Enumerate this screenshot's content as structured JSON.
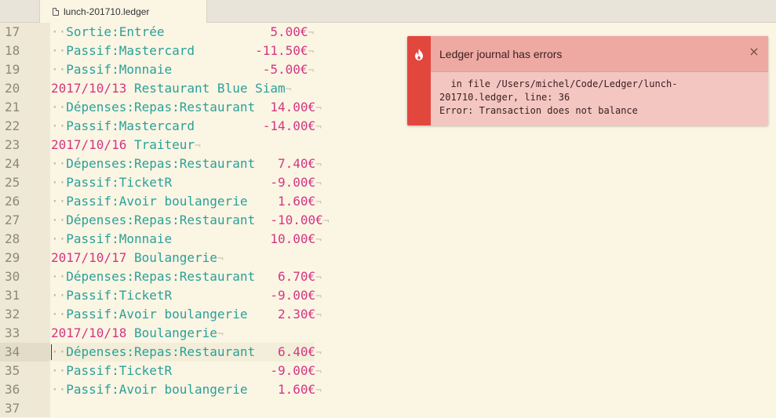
{
  "tab": {
    "filename": "lunch-201710.ledger"
  },
  "lines": [
    {
      "num": "17",
      "indent": true,
      "text": "Sortie:Entrée",
      "pad": "              ",
      "amount": "5.00€",
      "kind": "posting"
    },
    {
      "num": "18",
      "indent": true,
      "text": "Passif:Mastercard",
      "pad": "        ",
      "amount": "-11.50€",
      "kind": "posting"
    },
    {
      "num": "19",
      "indent": true,
      "text": "Passif:Monnaie",
      "pad": "            ",
      "amount": "-5.00€",
      "kind": "posting"
    },
    {
      "num": "20",
      "indent": false,
      "date": "2017/10/13",
      "text": "Restaurant Blue Siam",
      "kind": "header"
    },
    {
      "num": "21",
      "indent": true,
      "text": "Dépenses:Repas:Restaurant",
      "pad": "  ",
      "amount": "14.00€",
      "kind": "posting"
    },
    {
      "num": "22",
      "indent": true,
      "text": "Passif:Mastercard",
      "pad": "         ",
      "amount": "-14.00€",
      "kind": "posting"
    },
    {
      "num": "23",
      "indent": false,
      "date": "2017/10/16",
      "text": "Traiteur",
      "kind": "header"
    },
    {
      "num": "24",
      "indent": true,
      "text": "Dépenses:Repas:Restaurant",
      "pad": "   ",
      "amount": "7.40€",
      "kind": "posting"
    },
    {
      "num": "25",
      "indent": true,
      "text": "Passif:TicketR",
      "pad": "             ",
      "amount": "-9.00€",
      "kind": "posting"
    },
    {
      "num": "26",
      "indent": true,
      "text": "Passif:Avoir boulangerie",
      "pad": "    ",
      "amount": "1.60€",
      "kind": "posting"
    },
    {
      "num": "27",
      "indent": true,
      "text": "Dépenses:Repas:Restaurant",
      "pad": "  ",
      "amount": "-10.00€",
      "kind": "posting"
    },
    {
      "num": "28",
      "indent": true,
      "text": "Passif:Monnaie",
      "pad": "             ",
      "amount": "10.00€",
      "kind": "posting"
    },
    {
      "num": "29",
      "indent": false,
      "date": "2017/10/17",
      "text": "Boulangerie",
      "kind": "header"
    },
    {
      "num": "30",
      "indent": true,
      "text": "Dépenses:Repas:Restaurant",
      "pad": "   ",
      "amount": "6.70€",
      "kind": "posting"
    },
    {
      "num": "31",
      "indent": true,
      "text": "Passif:TicketR",
      "pad": "             ",
      "amount": "-9.00€",
      "kind": "posting"
    },
    {
      "num": "32",
      "indent": true,
      "text": "Passif:Avoir boulangerie",
      "pad": "    ",
      "amount": "2.30€",
      "kind": "posting"
    },
    {
      "num": "33",
      "indent": false,
      "date": "2017/10/18",
      "text": "Boulangerie",
      "kind": "header"
    },
    {
      "num": "34",
      "indent": true,
      "text": "Dépenses:Repas:Restaurant",
      "pad": "   ",
      "amount": "6.40€",
      "kind": "posting",
      "current": true
    },
    {
      "num": "35",
      "indent": true,
      "text": "Passif:TicketR",
      "pad": "             ",
      "amount": "-9.00€",
      "kind": "posting"
    },
    {
      "num": "36",
      "indent": true,
      "text": "Passif:Avoir boulangerie",
      "pad": "    ",
      "amount": "1.60€",
      "kind": "posting"
    },
    {
      "num": "37",
      "kind": "empty"
    }
  ],
  "notification": {
    "title": "Ledger journal has errors",
    "close_glyph": "×",
    "icon": "flame-icon",
    "detail_line1": "  in file /Users/michel/Code/Ledger/lunch-",
    "detail_line2": "201710.ledger, line: 36",
    "detail_line3": "Error: Transaction does not balance"
  },
  "colors": {
    "account": "#2aa198",
    "amount": "#d33682",
    "date": "#d33682",
    "error_accent": "#e2473e"
  }
}
